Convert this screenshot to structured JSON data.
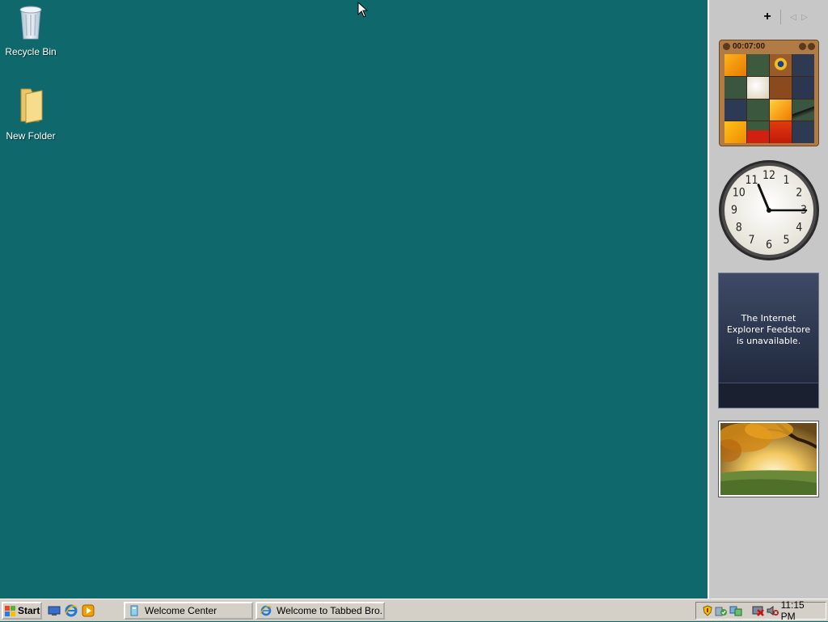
{
  "desktop": {
    "background_color": "#0f686b",
    "icons": [
      {
        "label": "Recycle Bin",
        "icon": "recycle-bin-icon"
      },
      {
        "label": "New Folder",
        "icon": "folder-icon"
      }
    ]
  },
  "sidebar": {
    "add_label": "+",
    "prev_label": "◁",
    "next_label": "▷",
    "puzzle": {
      "timer": "00:07:00"
    },
    "clock": {
      "hour": 11,
      "minute": 15
    },
    "feed": {
      "message": "The Internet Explorer Feedstore is unavailable."
    },
    "slideshow": {
      "image": "autumn-tree-landscape"
    }
  },
  "taskbar": {
    "start_label": "Start",
    "quick_launch": [
      "show-desktop-icon",
      "internet-explorer-icon",
      "media-player-icon"
    ],
    "buttons": [
      {
        "label": "Welcome Center",
        "icon": "welcome-center-icon"
      },
      {
        "label": "Welcome to Tabbed Bro...",
        "icon": "internet-explorer-icon"
      }
    ],
    "tray": {
      "icons": [
        "security-shield-icon",
        "windows-defender-icon",
        "network-icon",
        "network-disconnected-icon",
        "volume-muted-icon"
      ],
      "time": "11:15 PM"
    }
  }
}
